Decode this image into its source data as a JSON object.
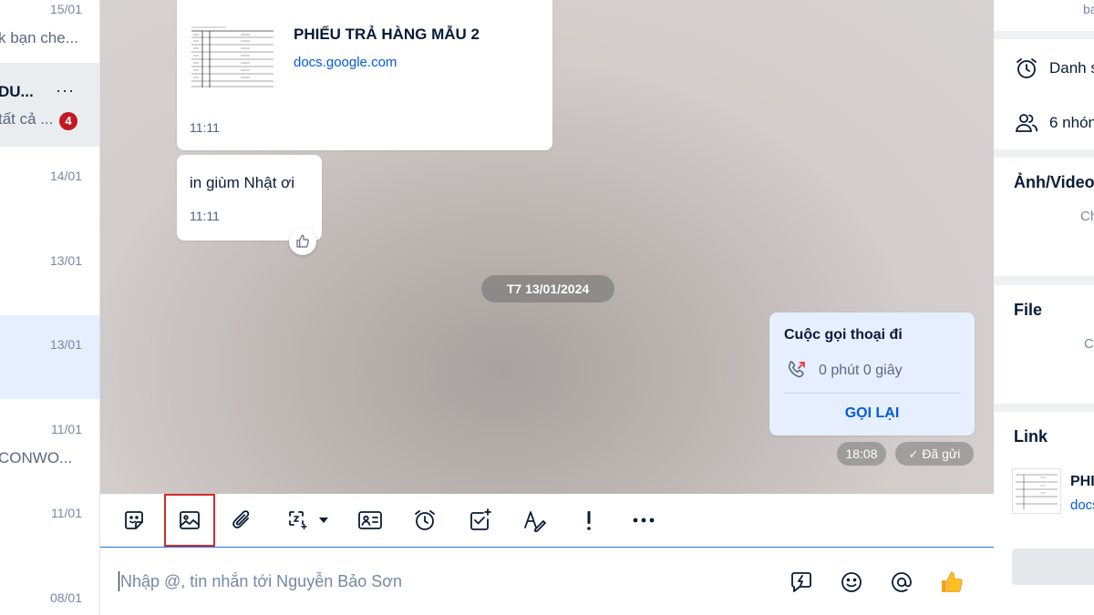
{
  "conversations": [
    {
      "date": "15/01",
      "preview": "k bạn che..."
    },
    {
      "name": "DU...",
      "preview": "tất cả ...",
      "badge": "4",
      "more": "···"
    },
    {
      "date": "14/01"
    },
    {
      "date": "13/01"
    },
    {
      "date": "13/01"
    },
    {
      "date": "11/01",
      "preview": "CONWO..."
    },
    {
      "date": "11/01"
    },
    {
      "date": "08/01"
    }
  ],
  "messages": {
    "link_card": {
      "title": "PHIẾU TRẢ HÀNG MẪU 2",
      "domain": "docs.google.com",
      "time": "11:11"
    },
    "text": {
      "body": "in giùm Nhật ơi",
      "time": "11:11"
    },
    "date_separator": "T7 13/01/2024",
    "call": {
      "title": "Cuộc gọi thoại đi",
      "duration": "0 phút 0 giây",
      "action": "GỌI LẠI"
    },
    "sent_time": "18:08",
    "sent_status": "Đã gửi"
  },
  "toolbar": {
    "icons": [
      "sticker-icon",
      "image-icon",
      "attachment-icon",
      "screenshot-icon",
      "contact-card-icon",
      "reminder-icon",
      "todo-icon",
      "format-text-icon",
      "important-icon",
      "more-icon"
    ]
  },
  "composer": {
    "placeholder": "Nhập @, tin nhắn tới Nguyễn Bảo Sơn"
  },
  "right_panel": {
    "top_text": "ba",
    "reminders": "Danh s",
    "groups": "6 nhón",
    "media_title": "Ảnh/Video",
    "media_empty": "Ch",
    "file_title": "File",
    "file_empty": "C",
    "link_title": "Link",
    "link_item_title": "PHI",
    "link_item_domain": "docs"
  },
  "colors": {
    "accent": "#005ae0",
    "badge": "#c31924",
    "highlight_box": "#d42a2a",
    "call_bubble": "#e5efff"
  }
}
